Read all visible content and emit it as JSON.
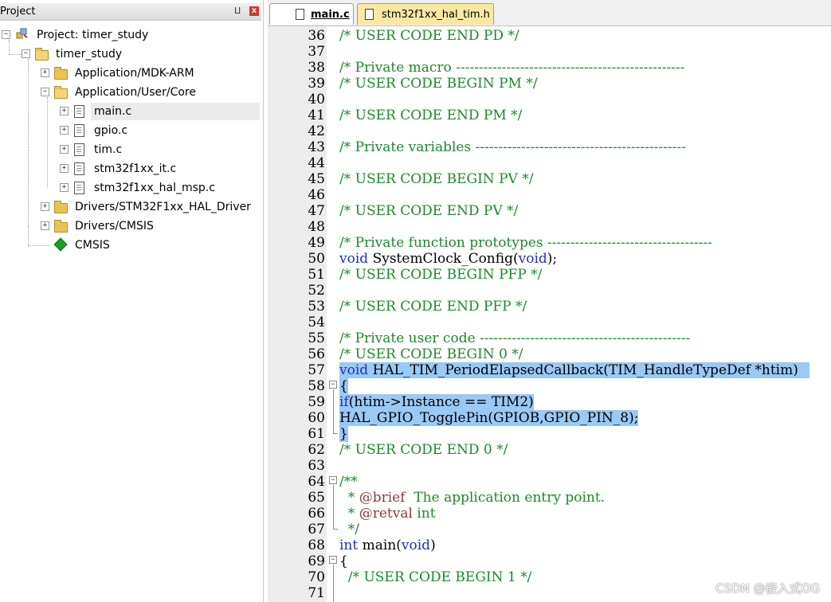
{
  "project_panel": {
    "title": "Project",
    "pin": "ⵡ",
    "close": "x",
    "tree": [
      {
        "label": "Project: timer_study",
        "kind": "project"
      },
      {
        "label": "timer_study",
        "kind": "target"
      },
      {
        "label": "Application/MDK-ARM",
        "kind": "folder"
      },
      {
        "label": "Application/User/Core",
        "kind": "folder-open"
      },
      {
        "label": "main.c",
        "kind": "file",
        "selected": true
      },
      {
        "label": "gpio.c",
        "kind": "file"
      },
      {
        "label": "tim.c",
        "kind": "file"
      },
      {
        "label": "stm32f1xx_it.c",
        "kind": "file"
      },
      {
        "label": "stm32f1xx_hal_msp.c",
        "kind": "file"
      },
      {
        "label": "Drivers/STM32F1xx_HAL_Driver",
        "kind": "folder"
      },
      {
        "label": "Drivers/CMSIS",
        "kind": "folder"
      },
      {
        "label": "CMSIS",
        "kind": "component"
      }
    ]
  },
  "editor": {
    "tabs": [
      {
        "label": "main.c",
        "active": true
      },
      {
        "label": "stm32f1xx_hal_tim.h",
        "active": false
      }
    ],
    "lines": [
      {
        "n": "36",
        "text": "/* USER CODE END PD */"
      },
      {
        "n": "37",
        "text": ""
      },
      {
        "n": "38",
        "text": "/* Private macro --------------------------------------------------"
      },
      {
        "n": "39",
        "text": "/* USER CODE BEGIN PM */"
      },
      {
        "n": "40",
        "text": ""
      },
      {
        "n": "41",
        "text": "/* USER CODE END PM */"
      },
      {
        "n": "42",
        "text": ""
      },
      {
        "n": "43",
        "text": "/* Private variables ----------------------------------------------"
      },
      {
        "n": "44",
        "text": ""
      },
      {
        "n": "45",
        "text": "/* USER CODE BEGIN PV */"
      },
      {
        "n": "46",
        "text": ""
      },
      {
        "n": "47",
        "text": "/* USER CODE END PV */"
      },
      {
        "n": "48",
        "text": ""
      },
      {
        "n": "49",
        "text": "/* Private function prototypes ------------------------------------"
      },
      {
        "n": "50",
        "text": "void SystemClock_Config(void);"
      },
      {
        "n": "51",
        "text": "/* USER CODE BEGIN PFP */"
      },
      {
        "n": "52",
        "text": ""
      },
      {
        "n": "53",
        "text": "/* USER CODE END PFP */"
      },
      {
        "n": "54",
        "text": ""
      },
      {
        "n": "55",
        "text": "/* Private user code ----------------------------------------------"
      },
      {
        "n": "56",
        "text": "/* USER CODE BEGIN 0 */"
      },
      {
        "n": "57",
        "text": "void HAL_TIM_PeriodElapsedCallback(TIM_HandleTypeDef *htim)"
      },
      {
        "n": "58",
        "text": "{"
      },
      {
        "n": "59",
        "text": "if(htim->Instance == TIM2)"
      },
      {
        "n": "60",
        "text": "HAL_GPIO_TogglePin(GPIOB,GPIO_PIN_8);"
      },
      {
        "n": "61",
        "text": "}"
      },
      {
        "n": "62",
        "text": "/* USER CODE END 0 */"
      },
      {
        "n": "63",
        "text": ""
      },
      {
        "n": "64",
        "text": "/**"
      },
      {
        "n": "65",
        "text": "  * @brief  The application entry point."
      },
      {
        "n": "66",
        "text": "  * @retval int"
      },
      {
        "n": "67",
        "text": "  */"
      },
      {
        "n": "68",
        "text": "int main(void)"
      },
      {
        "n": "69",
        "text": "{"
      },
      {
        "n": "70",
        "text": "  /* USER CODE BEGIN 1 */"
      },
      {
        "n": "71",
        "text": ""
      }
    ]
  },
  "watermark": "CSDN @嵌入式OG",
  "colors": {
    "comment": "#1a8a28",
    "keyword": "#1d2ec9",
    "selection": "#99c9f5",
    "gutter": "#ededed"
  }
}
